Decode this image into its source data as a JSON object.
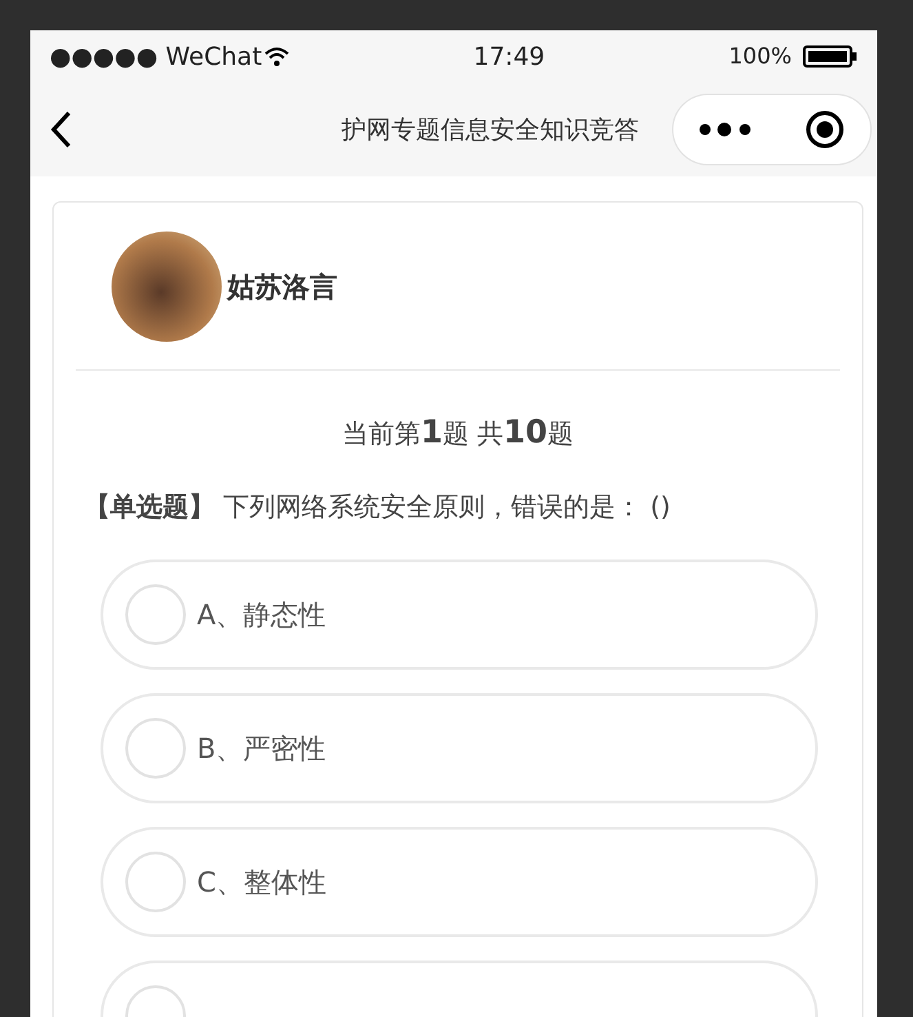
{
  "status_bar": {
    "signal": "●●●●● WeChat",
    "time": "17:49",
    "battery": "100%"
  },
  "nav_bar": {
    "title": "护网专题信息安全知识竞答"
  },
  "user": {
    "name": "姑苏洛言"
  },
  "progress": {
    "prefix": "当前第",
    "current": "1",
    "middle": "题 共",
    "total": "10",
    "suffix": "题"
  },
  "question": "**【单选题】** 下列网络系统安全原则，错误的是：  ()",
  "options": [
    {
      "label": "A、静态性",
      "selected": false
    },
    {
      "label": "B、严密性",
      "selected": false
    },
    {
      "label": "C、整体性",
      "selected": false
    },
    {
      "selected": false
    }
  ]
}
